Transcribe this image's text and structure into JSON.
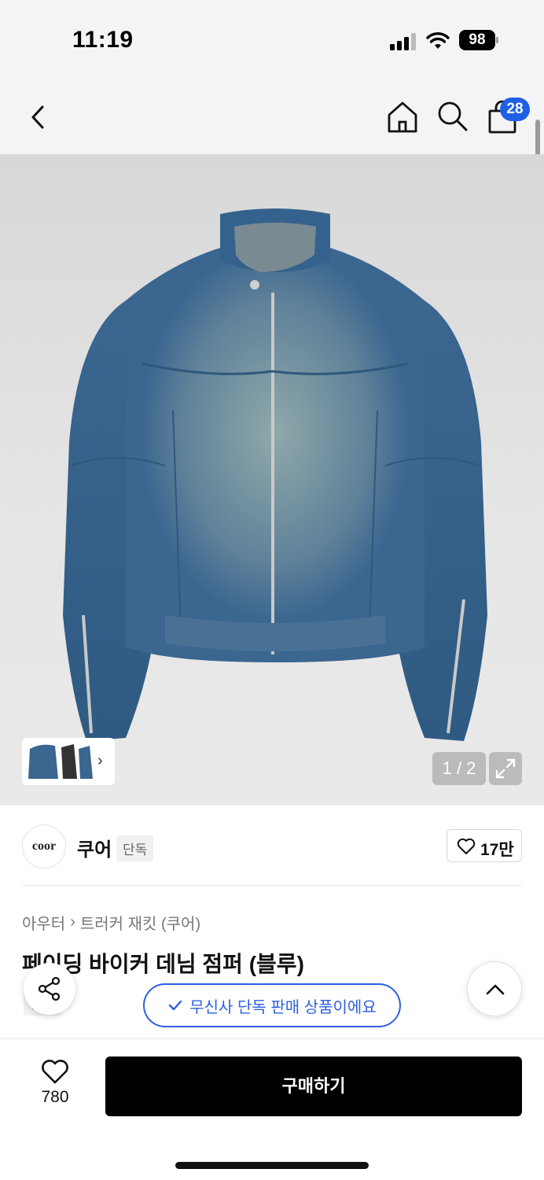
{
  "status_bar": {
    "time": "11:19",
    "battery": "98"
  },
  "nav": {
    "cart_count": "28"
  },
  "gallery": {
    "page_counter": "1 / 2"
  },
  "brand": {
    "logo_text": "coor",
    "name": "쿠어",
    "tag": "단독",
    "likes": "17만"
  },
  "breadcrumb": {
    "category": "아우터",
    "sub_category": "트러커 재킷 (쿠어)"
  },
  "product": {
    "title": "페이딩 바이커 데님 점퍼 (블루)",
    "tag": "단독"
  },
  "exclusive_notice": "무신사 단독 판매 상품이에요",
  "bottom_bar": {
    "like_count": "780",
    "buy_label": "구매하기"
  },
  "colors": {
    "accent_blue": "#2d5fe0",
    "badge_blue": "#1f5fe6",
    "buy_button": "#000000"
  },
  "icons": [
    "back-icon",
    "home-icon",
    "search-icon",
    "bag-icon",
    "expand-icon",
    "heart-icon",
    "share-icon",
    "chevron-up-icon",
    "check-icon"
  ]
}
